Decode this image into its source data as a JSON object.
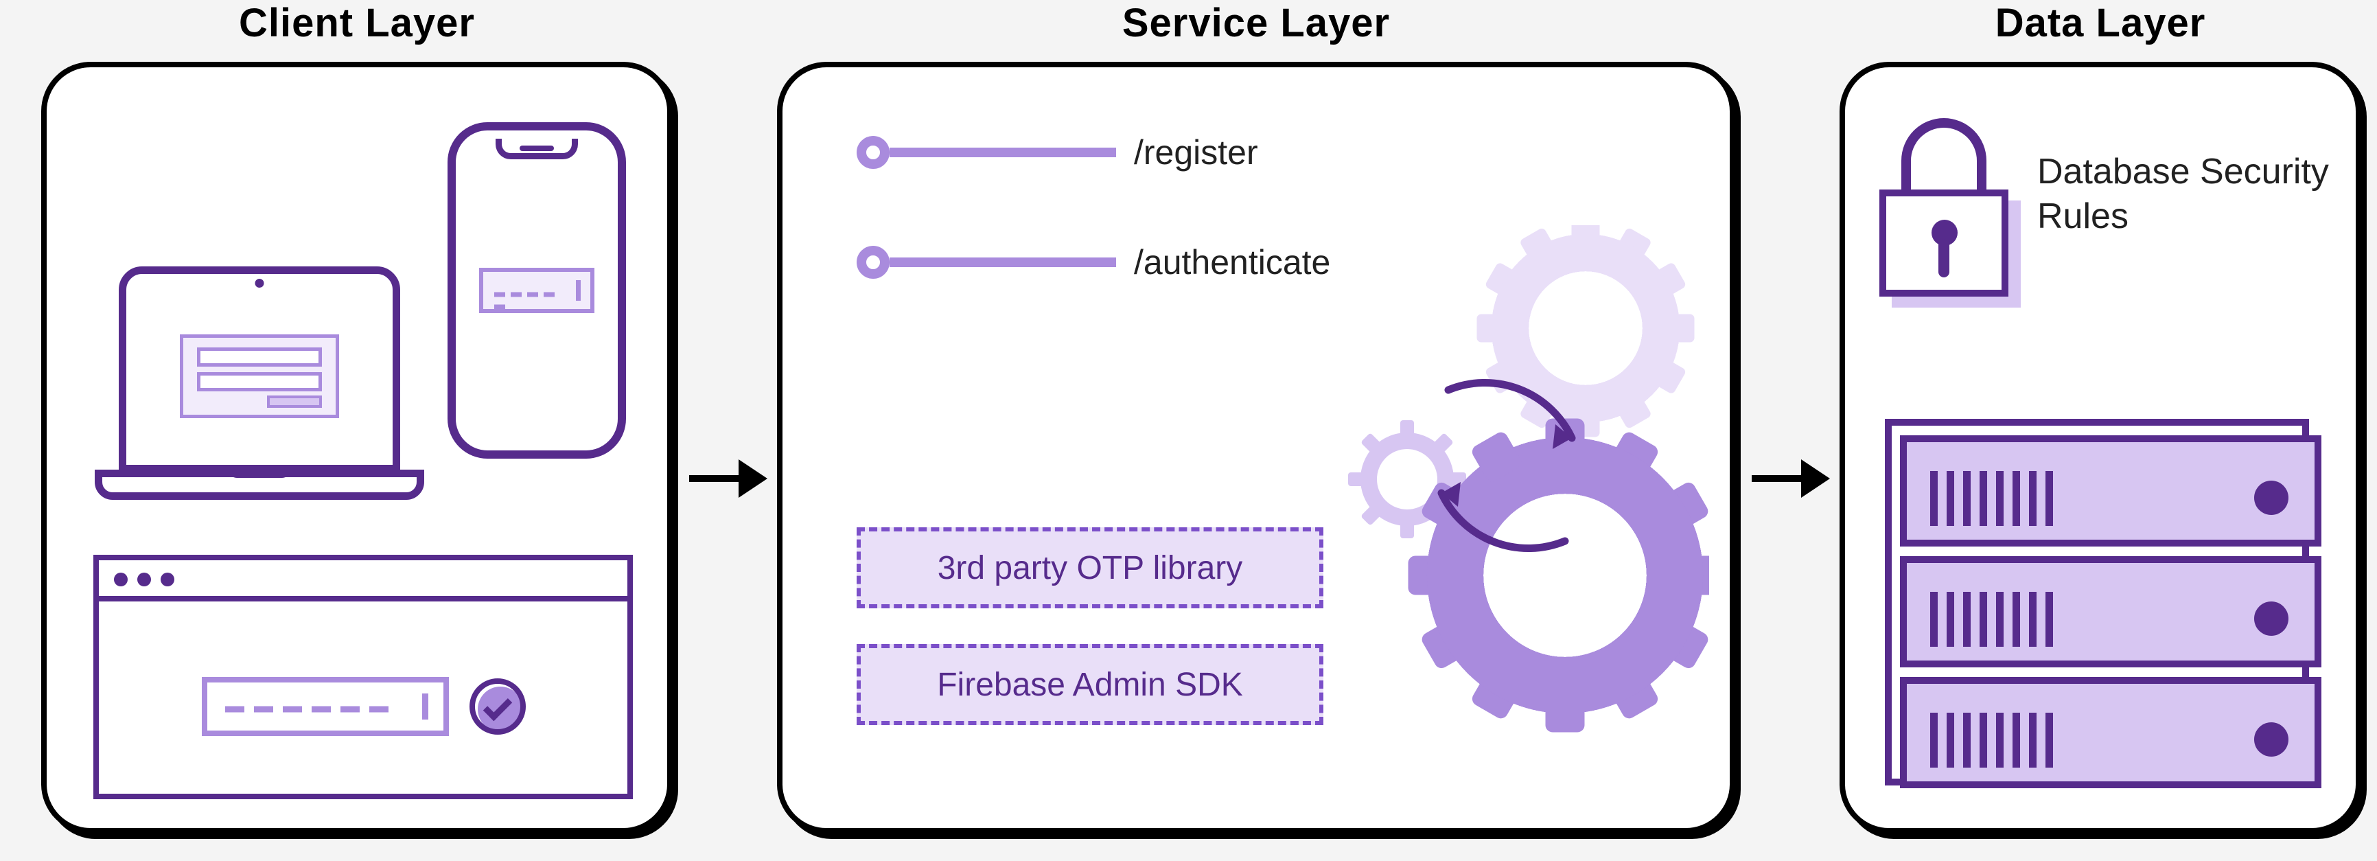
{
  "titles": {
    "client": "Client Layer",
    "service": "Service Layer",
    "data": "Data Layer"
  },
  "service": {
    "endpoints": {
      "register": "/register",
      "authenticate": "/authenticate"
    },
    "boxes": {
      "otp": "3rd party OTP library",
      "admin": "Firebase Admin SDK"
    }
  },
  "data_layer": {
    "security_rules": "Database Security Rules"
  },
  "colors": {
    "purple_dark": "#562b8c",
    "purple_light": "#a98bdd",
    "purple_lighter": "#d7c6f2"
  }
}
